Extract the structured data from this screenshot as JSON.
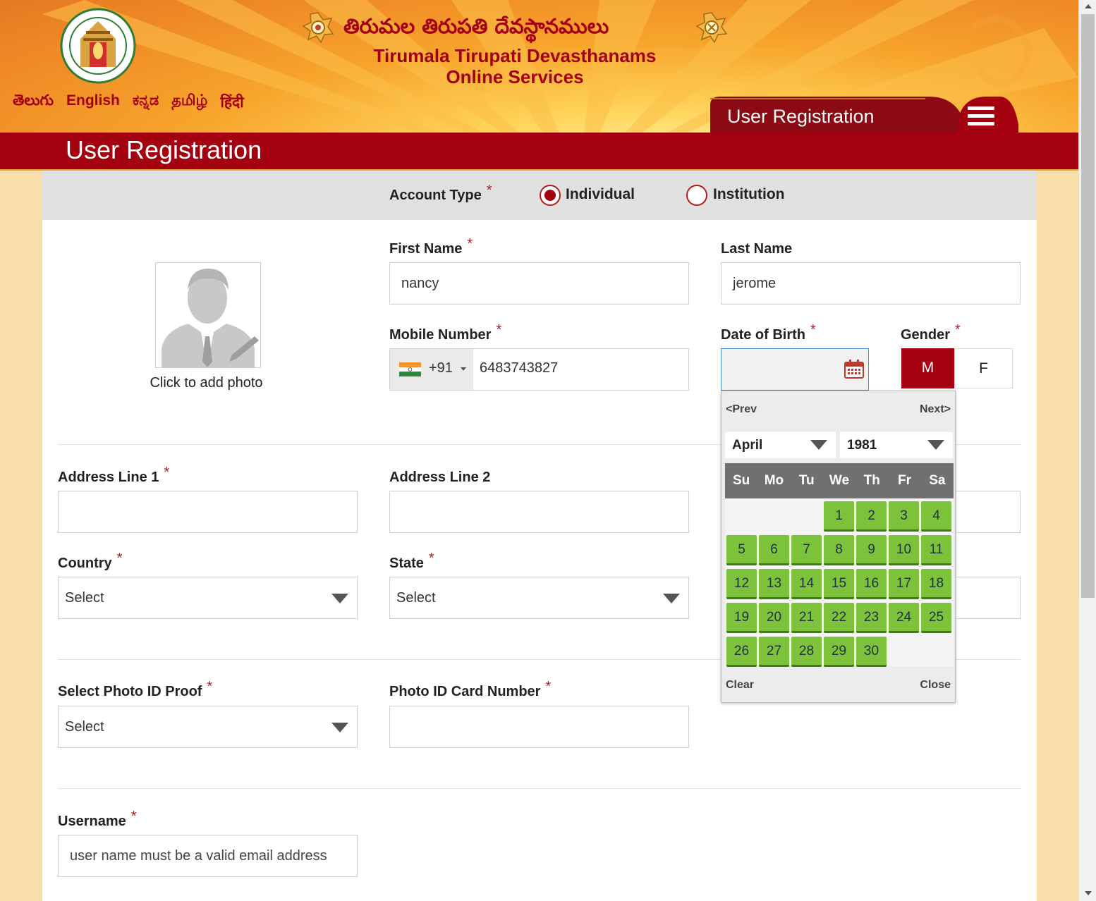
{
  "header": {
    "telugu_title": "తిరుమల తిరుపతి దేవస్థానములు",
    "english_title_line1": "Tirumala Tirupati Devasthanams",
    "english_title_line2": "Online Services",
    "languages": [
      "తెలుగు",
      "English",
      "ಕನ್ನಡ",
      "தமிழ்",
      "हिंदी"
    ],
    "tab_label": "User Registration",
    "menu_icon": "hamburger-menu-icon",
    "colors": {
      "brand_red": "#a30010",
      "saffron": "#f7a52c",
      "gold": "#ffd45a"
    }
  },
  "page_title": "User Registration",
  "form": {
    "account_type": {
      "label": "Account Type",
      "required": "*",
      "options": [
        "Individual",
        "Institution"
      ],
      "selected": "Individual"
    },
    "photo": {
      "caption": "Click to add photo",
      "icon": "user-avatar-placeholder-icon"
    },
    "first_name": {
      "label": "First Name",
      "required": "*",
      "value": "nancy"
    },
    "last_name": {
      "label": "Last Name",
      "value": "jerome"
    },
    "mobile": {
      "label": "Mobile Number",
      "required": "*",
      "dial_code": "+91",
      "value": "6483743827",
      "flag_icon": "india-flag-icon"
    },
    "dob": {
      "label": "Date of Birth",
      "required": "*",
      "value": "",
      "icon": "calendar-icon"
    },
    "gender": {
      "label": "Gender",
      "required": "*",
      "options": [
        "M",
        "F"
      ],
      "selected": "M"
    },
    "address1": {
      "label": "Address Line 1",
      "required": "*",
      "value": ""
    },
    "address2": {
      "label": "Address Line 2",
      "value": ""
    },
    "country": {
      "label": "Country",
      "required": "*",
      "value": "Select"
    },
    "state": {
      "label": "State",
      "required": "*",
      "value": "Select"
    },
    "photo_id_proof": {
      "label": "Select Photo ID Proof",
      "required": "*",
      "value": "Select"
    },
    "photo_id_number": {
      "label": "Photo ID Card Number",
      "required": "*",
      "value": ""
    },
    "username": {
      "label": "Username",
      "required": "*",
      "placeholder": "user name must be a valid email address"
    }
  },
  "datepicker": {
    "prev": "<Prev",
    "next": "Next>",
    "month": "April",
    "year": "1981",
    "weekdays": [
      "Su",
      "Mo",
      "Tu",
      "We",
      "Th",
      "Fr",
      "Sa"
    ],
    "first_weekday_index": 3,
    "days_in_month": 30,
    "clear": "Clear",
    "close": "Close",
    "day_color": "#7cc23a",
    "header_color": "#707070"
  }
}
